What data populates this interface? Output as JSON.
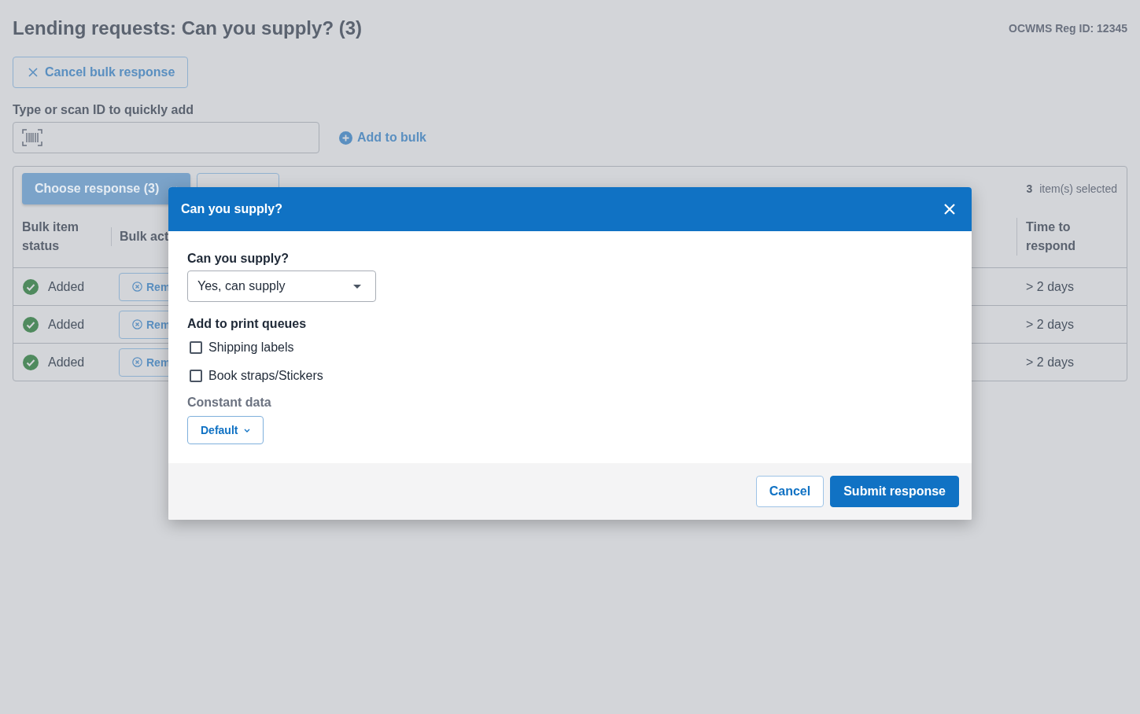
{
  "page": {
    "title": "Lending requests: Can you supply? (3)",
    "reg_id": "OCWMS Reg ID: 12345"
  },
  "cancel_bulk_button": "Cancel bulk response",
  "quick_add": {
    "label": "Type or scan ID to quickly add",
    "add_button": "Add to bulk"
  },
  "toolbar": {
    "choose_button": "Choose response (3)",
    "selected_count": "3",
    "selected_label": "item(s) selected"
  },
  "table": {
    "columns": [
      "Bulk item status",
      "Bulk act",
      "Time to respond"
    ],
    "rows": [
      {
        "status": "Added",
        "action": "Rem",
        "time": "> 2 days"
      },
      {
        "status": "Added",
        "action": "Rem",
        "time": "> 2 days"
      },
      {
        "status": "Added",
        "action": "Rem",
        "time": "> 2 days"
      }
    ]
  },
  "dialog": {
    "title": "Can you supply?",
    "supply_label": "Can you supply?",
    "supply_value": "Yes, can supply",
    "print_label": "Add to print queues",
    "print_queues": [
      {
        "label": "Shipping labels",
        "checked": false
      },
      {
        "label": "Book straps/Stickers",
        "checked": false
      }
    ],
    "constant_label": "Constant data",
    "constant_value": "Default",
    "buttons": [
      {
        "label": "Cancel",
        "kind": "secondary"
      },
      {
        "label": "Submit response",
        "kind": "primary"
      }
    ]
  }
}
